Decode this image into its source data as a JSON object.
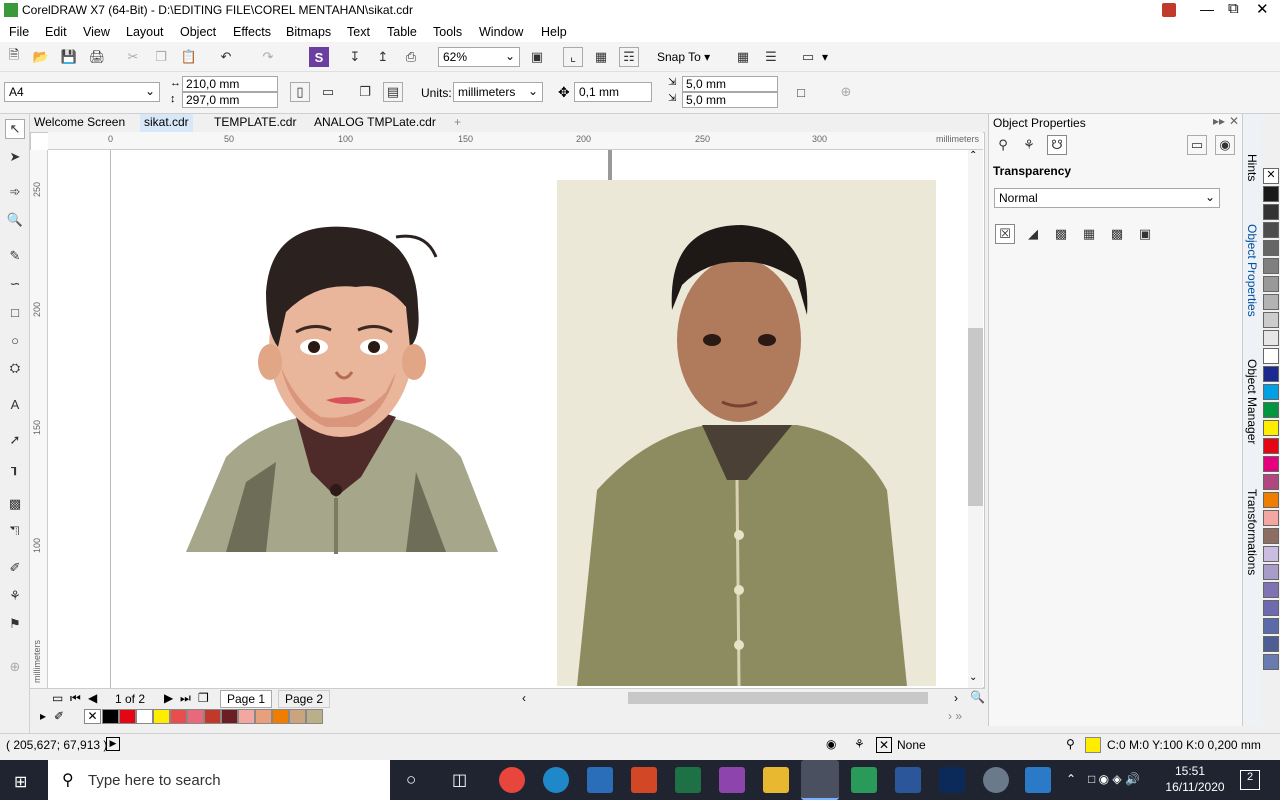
{
  "window": {
    "title": "CorelDRAW X7 (64-Bit) - D:\\EDITING FILE\\COREL MENTAHAN\\sikat.cdr"
  },
  "menu": [
    "File",
    "Edit",
    "View",
    "Layout",
    "Object",
    "Effects",
    "Bitmaps",
    "Text",
    "Table",
    "Tools",
    "Window",
    "Help"
  ],
  "toolbar": {
    "zoom": "62%",
    "snap_to": "Snap To"
  },
  "property_bar": {
    "page_size": "A4",
    "width": "210,0 mm",
    "height": "297,0 mm",
    "units_label": "Units:",
    "units": "millimeters",
    "nudge": "0,1 mm",
    "dup_x": "5,0 mm",
    "dup_y": "5,0 mm"
  },
  "doc_tabs": [
    "Welcome Screen",
    "sikat.cdr",
    "TEMPLATE.cdr",
    "ANALOG TMPLate.cdr"
  ],
  "ruler": {
    "h_labels": [
      "0",
      "50",
      "100",
      "150",
      "200",
      "250",
      "300"
    ],
    "h_unit": "millimeters",
    "v_labels": [
      "250",
      "200",
      "150",
      "100"
    ],
    "v_unit": "millimeters"
  },
  "pages": {
    "count": "1 of 2",
    "tabs": [
      "Page 1",
      "Page 2"
    ]
  },
  "status": {
    "coords": "( 205,627; 67,913 )",
    "fill_label": "None",
    "outline": "C:0 M:0 Y:100 K:0  0,200 mm"
  },
  "docker": {
    "title": "Object Properties",
    "section": "Transparency",
    "mode": "Normal"
  },
  "docker_tabs": [
    "Hints",
    "Object Properties",
    "Object Manager",
    "Transformations"
  ],
  "taskbar": {
    "search": "Type here to search",
    "time": "15:51",
    "date": "16/11/2020",
    "notif": "2"
  },
  "palette_colors": [
    "#000000",
    "#e30613",
    "#ffffff",
    "#ffed00",
    "#e94e4e",
    "#e86a7a",
    "#c0392b",
    "#6b1e24",
    "#f4a7a0",
    "#e8a07c",
    "#ee7d00",
    "#c9a47e",
    "#b9b08a"
  ],
  "right_palette": [
    "#1a1a1a",
    "#333333",
    "#4d4d4d",
    "#666666",
    "#808080",
    "#999999",
    "#b3b3b3",
    "#cccccc",
    "#e6e6e6",
    "#ffffff",
    "#1b2a8f",
    "#00a0e3",
    "#009640",
    "#ffed00",
    "#e30613",
    "#e5007d",
    "#b2467f",
    "#ee7d00",
    "#f4a7a0",
    "#8c6e63",
    "#cbbde2",
    "#a89cc8",
    "#7f73b4",
    "#6d6ab0",
    "#5b6aa8",
    "#4e5d94",
    "#6a7bb0"
  ]
}
